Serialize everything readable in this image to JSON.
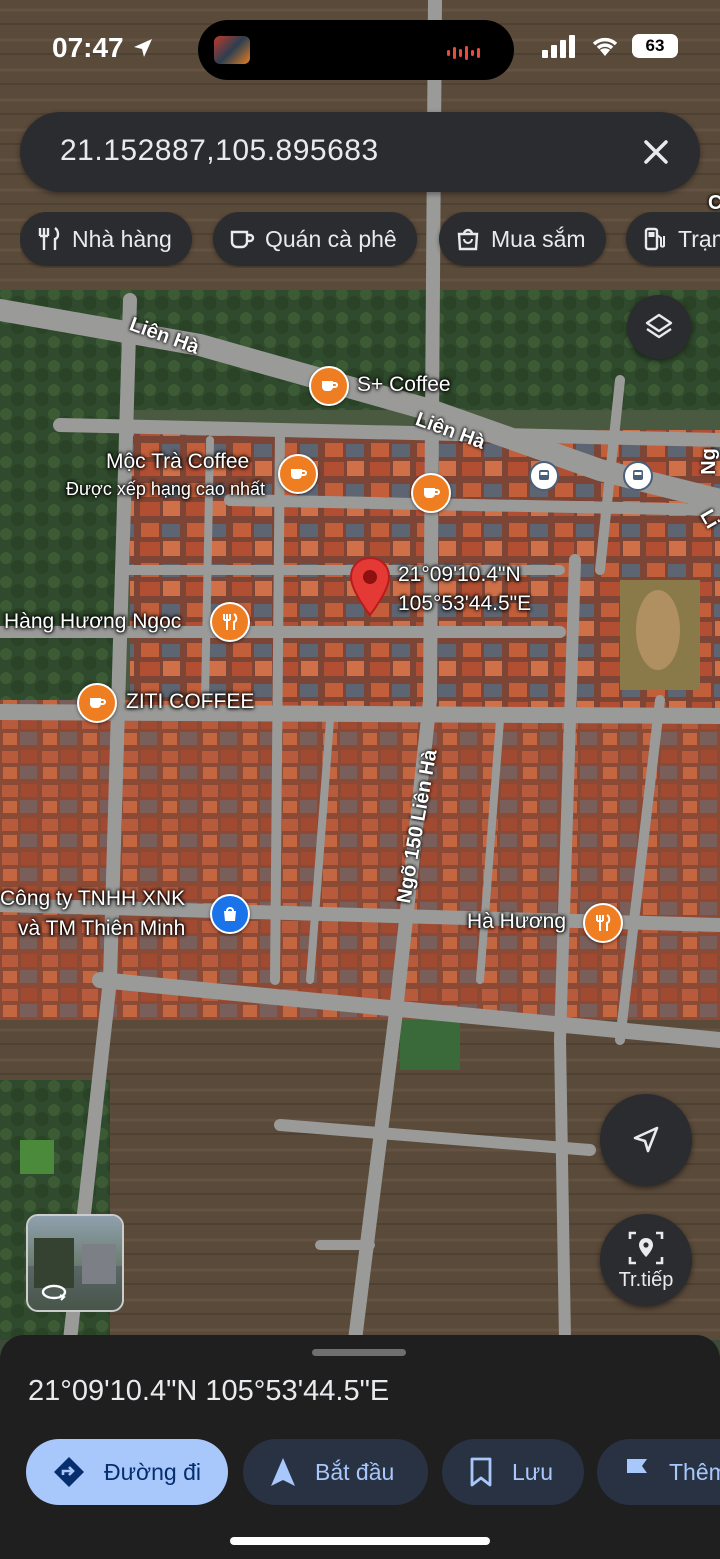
{
  "status_bar": {
    "time": "07:47",
    "battery": "63"
  },
  "search": {
    "query": "21.152887,105.895683"
  },
  "chips": [
    {
      "label": "Nhà hàng",
      "icon": "fork-knife-icon"
    },
    {
      "label": "Quán cà phê",
      "icon": "coffee-cup-icon"
    },
    {
      "label": "Mua sắm",
      "icon": "shopping-bag-icon"
    },
    {
      "label": "Trạm",
      "icon": "gas-station-icon"
    }
  ],
  "map": {
    "roads": [
      "Liên Hà",
      "Liên Hà",
      "Ngõ 150 Liên Hà"
    ],
    "places": [
      {
        "name": "S+ Coffee",
        "type": "coffee"
      },
      {
        "name": "Mộc Trà Coffee",
        "subtitle": "Được xếp hạng cao nhất",
        "type": "coffee"
      },
      {
        "name": "Hàng Hương Ngọc",
        "type": "restaurant"
      },
      {
        "name": "ZITI COFFEE",
        "type": "coffee"
      },
      {
        "name": "Công ty TNHH XNK",
        "name2": "và TM Thiên Minh",
        "type": "shop"
      },
      {
        "name": "Hà Hương",
        "type": "restaurant"
      }
    ],
    "pin": {
      "lat_text": "21°09'10.4\"N",
      "lng_text": "105°53'44.5\"E"
    },
    "edge_fragments": [
      "C",
      "Ng",
      "Li"
    ]
  },
  "buttons": {
    "live_view": "Tr.tiếp"
  },
  "sheet": {
    "coordinates": "21°09'10.4\"N 105°53'44.5\"E",
    "actions": [
      {
        "label": "Đường đi",
        "icon": "directions-icon"
      },
      {
        "label": "Bắt đầu",
        "icon": "navigation-arrow-icon"
      },
      {
        "label": "Lưu",
        "icon": "bookmark-icon"
      },
      {
        "label": "Thêm",
        "icon": "flag-icon"
      }
    ]
  },
  "colors": {
    "accent": "#a8c7fa",
    "poi_orange": "#ef7d22",
    "pin_red": "#e53935",
    "panel": "#2b2c2f"
  }
}
